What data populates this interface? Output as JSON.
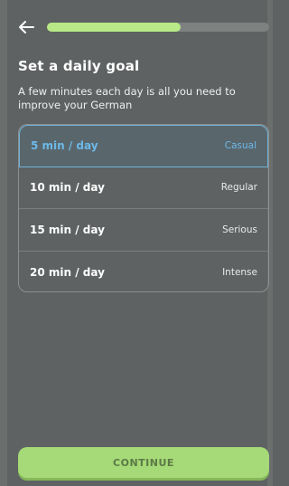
{
  "header": {
    "back_icon": "arrow-left-icon",
    "progress": 0.6
  },
  "title": "Set a daily goal",
  "subtitle": "A few minutes each day is all you need to improve your German",
  "options": [
    {
      "time": "5 min / day",
      "level": "Casual",
      "selected": true
    },
    {
      "time": "10 min / day",
      "level": "Regular",
      "selected": false
    },
    {
      "time": "15 min / day",
      "level": "Serious",
      "selected": false
    },
    {
      "time": "20 min / day",
      "level": "Intense",
      "selected": false
    }
  ],
  "continue_label": "CONTINUE",
  "colors": {
    "background": "#5e6262",
    "progress": "#b8e986",
    "selected_accent": "#6db8e8",
    "button": "#a6d977"
  }
}
